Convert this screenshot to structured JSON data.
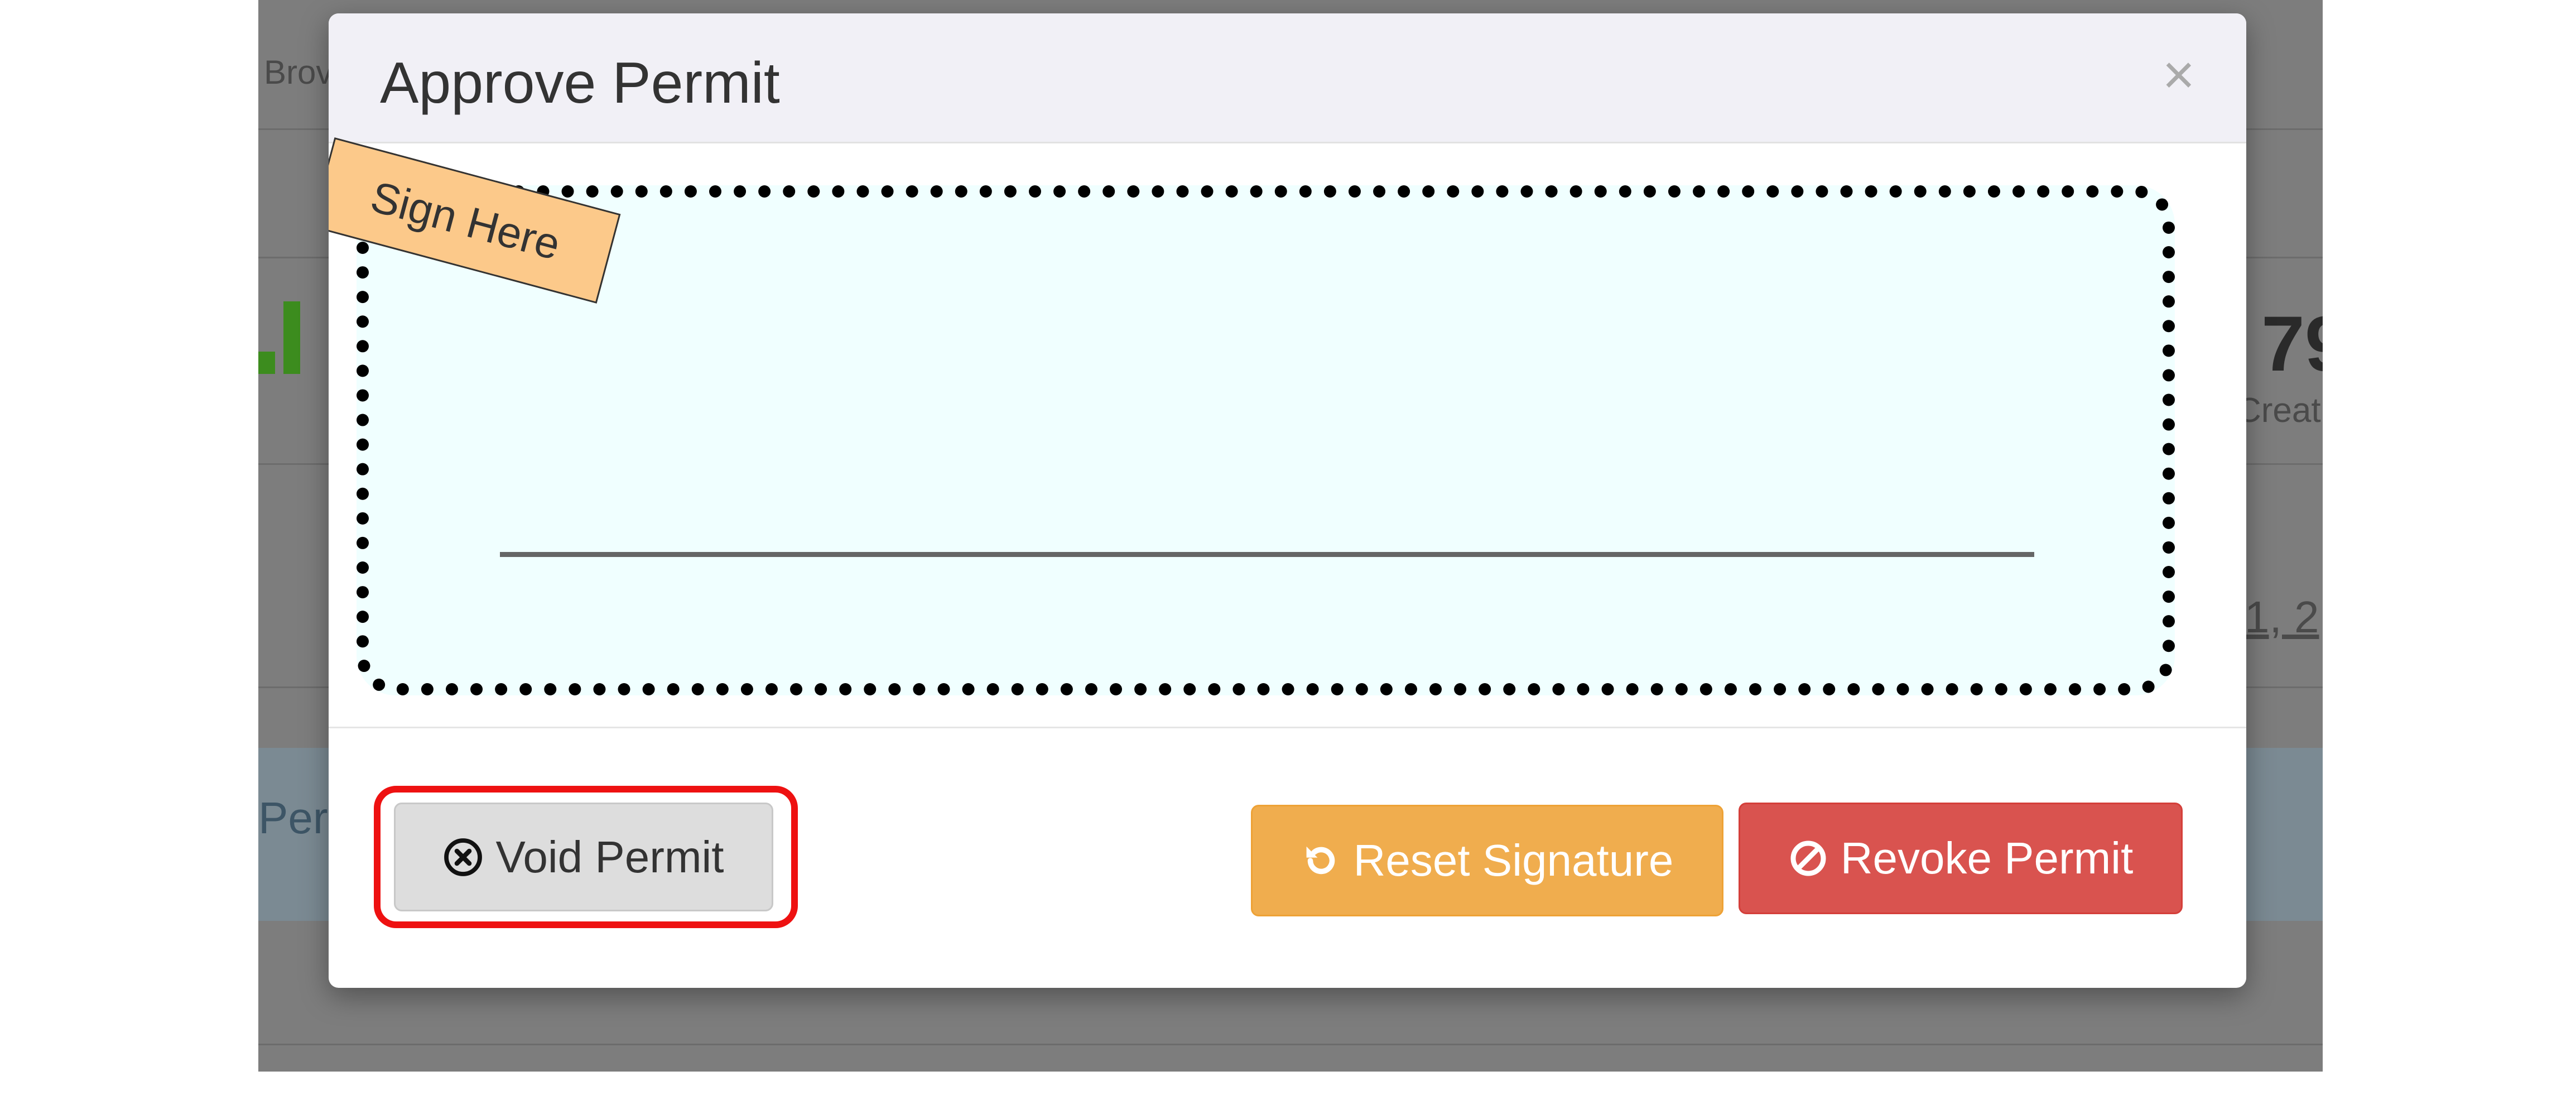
{
  "background": {
    "fragments": {
      "tab_text": "Brov",
      "stat_number": "79",
      "stat_label": "Creat",
      "date_text": "1, 2",
      "row_text": "Per"
    },
    "colors": {
      "logo_green": "#3c8c1e",
      "checkbox_blue": "#2c6aa8"
    }
  },
  "modal": {
    "title": "Approve Permit",
    "close_symbol": "×",
    "signature_pad": {
      "sign_here_label": "Sign Here",
      "background_color": "#f0ffff",
      "sticker_color": "#fcc98a"
    },
    "footer": {
      "void_button": {
        "label": "Void Permit",
        "icon": "times-circle-icon",
        "highlighted": true,
        "highlight_color": "#ee1111"
      },
      "reset_button": {
        "label": "Reset Signature",
        "icon": "undo-icon",
        "color": "#f0ad4e"
      },
      "revoke_button": {
        "label": "Revoke Permit",
        "icon": "ban-icon",
        "color": "#d9534f"
      }
    }
  }
}
